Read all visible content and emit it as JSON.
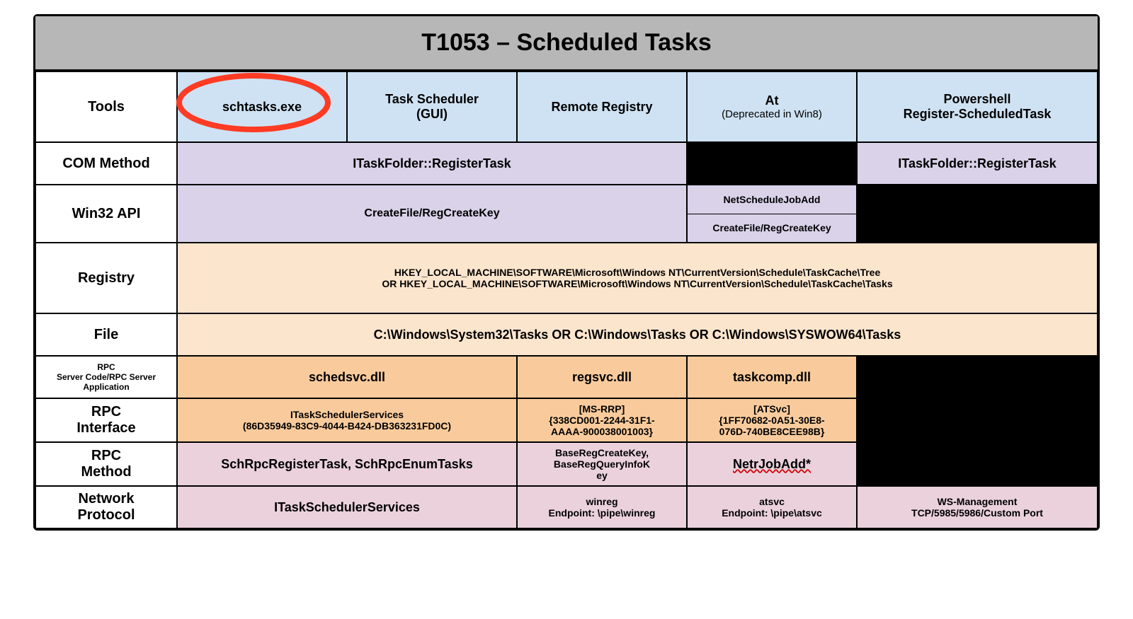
{
  "title": "T1053 – Scheduled Tasks",
  "row_labels": {
    "tools": "Tools",
    "com": "COM Method",
    "api": "Win32 API",
    "registry": "Registry",
    "file": "File",
    "rpc_server_1": "RPC",
    "rpc_server_2": "Server Code/RPC Server",
    "rpc_server_3": "Application",
    "rpc_if_1": "RPC",
    "rpc_if_2": "Interface",
    "rpc_m_1": "RPC",
    "rpc_m_2": "Method",
    "net_1": "Network",
    "net_2": "Protocol"
  },
  "tools": {
    "schtasks": "schtasks.exe",
    "gui_1": "Task Scheduler",
    "gui_2": "(GUI)",
    "remote_reg": "Remote Registry",
    "at_1": "At",
    "at_2": "(Deprecated in Win8)",
    "ps_1": "Powershell",
    "ps_2": "Register-ScheduledTask"
  },
  "com": {
    "register": "ITaskFolder::RegisterTask",
    "ps": "ITaskFolder::RegisterTask"
  },
  "api": {
    "main": "CreateFile/RegCreateKey",
    "at_top": "NetScheduleJobAdd",
    "at_bot": "CreateFile/RegCreateKey"
  },
  "registry_1": "HKEY_LOCAL_MACHINE\\SOFTWARE\\Microsoft\\Windows NT\\CurrentVersion\\Schedule\\TaskCache\\Tree",
  "registry_2": "OR HKEY_LOCAL_MACHINE\\SOFTWARE\\Microsoft\\Windows NT\\CurrentVersion\\Schedule\\TaskCache\\Tasks",
  "file": "C:\\Windows\\System32\\Tasks OR C:\\Windows\\Tasks OR C:\\Windows\\SYSWOW64\\Tasks",
  "rpc_server": {
    "sched": "schedsvc.dll",
    "reg": "regsvc.dll",
    "task": "taskcomp.dll"
  },
  "rpc_if": {
    "a_1": "ITaskSchedulerServices",
    "a_2": "(86D35949-83C9-4044-B424-DB363231FD0C)",
    "b_1": "[MS-RRP]",
    "b_2": "{338CD001-2244-31F1-",
    "b_3": "AAAA-900038001003}",
    "c_1": "[ATSvc]",
    "c_2": "{1FF70682-0A51-30E8-",
    "c_3": "076D-740BE8CEE98B}"
  },
  "rpc_m": {
    "a": "SchRpcRegisterTask, SchRpcEnumTasks",
    "b_1": "BaseRegCreateKey,",
    "b_2": "BaseRegQueryInfoK",
    "b_3": "ey",
    "c": "NetrJobAdd*"
  },
  "net": {
    "a": "ITaskSchedulerServices",
    "b_1": "winreg",
    "b_2": "Endpoint: \\pipe\\winreg",
    "c_1": "atsvc",
    "c_2": "Endpoint: \\pipe\\atsvc",
    "d_1": "WS-Management",
    "d_2": "TCP/5985/5986/Custom Port"
  }
}
